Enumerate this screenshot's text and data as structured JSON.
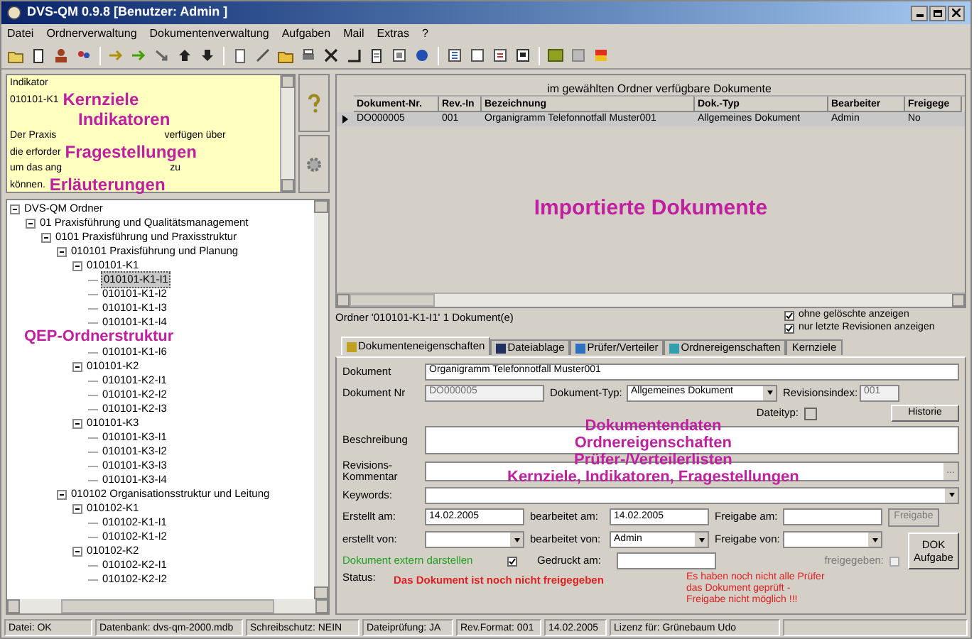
{
  "window": {
    "title": "DVS-QM 0.9.8  [Benutzer: Admin ]"
  },
  "menu": [
    "Datei",
    "Ordnerverwaltung",
    "Dokumentenverwaltung",
    "Aufgaben",
    "Mail",
    "Extras",
    "?"
  ],
  "info_box": {
    "lines": [
      [
        {
          "kind": "text",
          "text": "Indikator"
        }
      ],
      [
        {
          "kind": "text",
          "text": "010101-K1"
        },
        {
          "kind": "annotation",
          "text": "Kernziele"
        }
      ],
      [
        {
          "kind": "annotation",
          "text": "Indikatoren"
        }
      ],
      [
        {
          "kind": "text",
          "text": "Der Praxis"
        },
        {
          "kind": "gap"
        },
        {
          "kind": "text",
          "text": "verfügen über"
        }
      ],
      [
        {
          "kind": "text",
          "text": "die erforder"
        },
        {
          "kind": "annotation",
          "text": "Fragestellungen"
        }
      ],
      [
        {
          "kind": "text",
          "text": "um das ang"
        },
        {
          "kind": "gap"
        },
        {
          "kind": "text",
          "text": "zu"
        }
      ],
      [
        {
          "kind": "text",
          "text": "können."
        },
        {
          "kind": "annotation",
          "text": "Erläuterungen"
        }
      ]
    ]
  },
  "tree": [
    {
      "label": "DVS-QM Ordner",
      "kind": "node",
      "expanded": true,
      "selected": false,
      "children": [
        {
          "label": "01 Praxisführung und Qualitätsmanagement",
          "kind": "node",
          "expanded": true,
          "selected": false,
          "children": [
            {
              "label": "0101 Praxisführung und Praxisstruktur",
              "kind": "node",
              "expanded": true,
              "selected": false,
              "children": [
                {
                  "label": "010101 Praxisführung und Planung",
                  "kind": "node",
                  "expanded": true,
                  "selected": false,
                  "children": [
                    {
                      "label": "010101-K1",
                      "kind": "node",
                      "expanded": true,
                      "selected": false,
                      "children": [
                        {
                          "label": "010101-K1-I1",
                          "kind": "node",
                          "selected": true
                        },
                        {
                          "label": "010101-K1-I2",
                          "kind": "node",
                          "selected": false
                        },
                        {
                          "label": "010101-K1-I3",
                          "kind": "node",
                          "selected": false
                        },
                        {
                          "label": "010101-K1-I4",
                          "kind": "node",
                          "selected": false
                        },
                        {
                          "label": "QEP-Ordnerstruktur",
                          "kind": "annotation"
                        },
                        {
                          "label": "010101-K1-I6",
                          "kind": "node",
                          "selected": false
                        }
                      ]
                    },
                    {
                      "label": "010101-K2",
                      "kind": "node",
                      "expanded": true,
                      "selected": false,
                      "children": [
                        {
                          "label": "010101-K2-I1",
                          "kind": "node",
                          "selected": false
                        },
                        {
                          "label": "010101-K2-I2",
                          "kind": "node",
                          "selected": false
                        },
                        {
                          "label": "010101-K2-I3",
                          "kind": "node",
                          "selected": false
                        }
                      ]
                    },
                    {
                      "label": "010101-K3",
                      "kind": "node",
                      "expanded": true,
                      "selected": false,
                      "children": [
                        {
                          "label": "010101-K3-I1",
                          "kind": "node",
                          "selected": false
                        },
                        {
                          "label": "010101-K3-I2",
                          "kind": "node",
                          "selected": false
                        },
                        {
                          "label": "010101-K3-I3",
                          "kind": "node",
                          "selected": false
                        },
                        {
                          "label": "010101-K3-I4",
                          "kind": "node",
                          "selected": false
                        }
                      ]
                    }
                  ]
                },
                {
                  "label": "010102 Organisationsstruktur und Leitung",
                  "kind": "node",
                  "expanded": true,
                  "selected": false,
                  "children": [
                    {
                      "label": "010102-K1",
                      "kind": "node",
                      "expanded": true,
                      "selected": false,
                      "children": [
                        {
                          "label": "010102-K1-I1",
                          "kind": "node",
                          "selected": false
                        },
                        {
                          "label": "010102-K1-I2",
                          "kind": "node",
                          "selected": false
                        }
                      ]
                    },
                    {
                      "label": "010102-K2",
                      "kind": "node",
                      "expanded": true,
                      "selected": false,
                      "children": [
                        {
                          "label": "010102-K2-I1",
                          "kind": "node",
                          "selected": false
                        },
                        {
                          "label": "010102-K2-I2",
                          "kind": "node",
                          "selected": false
                        }
                      ]
                    }
                  ]
                }
              ]
            }
          ]
        }
      ]
    }
  ],
  "documents": {
    "title": "im gewählten Ordner verfügbare Dokumente",
    "columns": [
      "Dokument-Nr.",
      "Rev.-In",
      "Bezeichnung",
      "Dok.-Typ",
      "Bearbeiter",
      "Freigege"
    ],
    "rows": [
      {
        "selected": true,
        "cells": [
          "DO000005",
          "001",
          "Organigramm Telefonnotfall Muster001",
          "Allgemeines Dokument",
          "Admin",
          "No"
        ]
      }
    ],
    "annotation": "Importierte Dokumente",
    "summary": "Ordner '010101-K1-I1'  1 Dokument(e)",
    "options": [
      {
        "label": "ohne gelöschte anzeigen",
        "checked": true
      },
      {
        "label": "nur letzte Revisionen anzeigen",
        "checked": true
      }
    ]
  },
  "tabs": [
    {
      "label": "Dokumenteneigenschaften",
      "selected": true
    },
    {
      "label": "Dateiablage",
      "selected": false
    },
    {
      "label": "Prüfer/Verteiler",
      "selected": false
    },
    {
      "label": "Ordnereigenschaften",
      "selected": false
    },
    {
      "label": "Kernziele",
      "selected": false
    }
  ],
  "form": {
    "dokument": {
      "label": "Dokument",
      "value": "Organigramm Telefonnotfall Muster001"
    },
    "dokument_nr": {
      "label": "Dokument Nr",
      "value": "DO000005",
      "disabled": true
    },
    "dokument_typ": {
      "label": "Dokument-Typ:",
      "value": "Allgemeines Dokument"
    },
    "revisionsindex": {
      "label": "Revisionsindex:",
      "value": "001",
      "disabled": true
    },
    "dateityp": {
      "label": "Dateityp:"
    },
    "historie_button": "Historie",
    "beschreibung": {
      "label": "Beschreibung"
    },
    "revisionskommentar": {
      "label": "Revisions-\nKommentar",
      "button": "..."
    },
    "keywords": {
      "label": "Keywords:"
    },
    "erstellt_am": {
      "label": "Erstellt am:",
      "value": "14.02.2005"
    },
    "bearbeitet_am": {
      "label": "bearbeitet am:",
      "value": "14.02.2005"
    },
    "freigabe_am": {
      "label": "Freigabe am:"
    },
    "freigabe_button": {
      "label": "Freigabe",
      "disabled": true
    },
    "erstellt_von": {
      "label": "erstellt von:"
    },
    "bearbeitet_von": {
      "label": "bearbeitet von:",
      "value": "Admin"
    },
    "freigabe_von": {
      "label": "Freigabe von:"
    },
    "dok_aufgabe_button": "DOK\nAufgabe",
    "extern": {
      "label": "Dokument extern darstellen",
      "checked": true
    },
    "gedruckt_am": {
      "label": "Gedruckt am:"
    },
    "freigegeben": {
      "label": "freigegeben:",
      "checked": false,
      "disabled": true
    },
    "status_label": "Status:",
    "status": "Das Dokument ist noch nicht freigegeben",
    "warning": "Es haben noch nicht alle Prüfer das Dokument geprüft - Freigabe nicht möglich !!!",
    "annotations": [
      "Dokumentendaten",
      "Ordnereigenschaften",
      "Prüfer-/Verteilerlisten",
      "Kernziele, Indikatoren, Fragestellungen"
    ]
  },
  "status_bar": [
    "Datei: OK",
    "Datenbank: dvs-qm-2000.mdb",
    "Schreibschutz: NEIN",
    "Dateiprüfung: JA",
    "Rev.Format: 001",
    "14.02.2005",
    "Lizenz für: Grünebaum Udo"
  ]
}
